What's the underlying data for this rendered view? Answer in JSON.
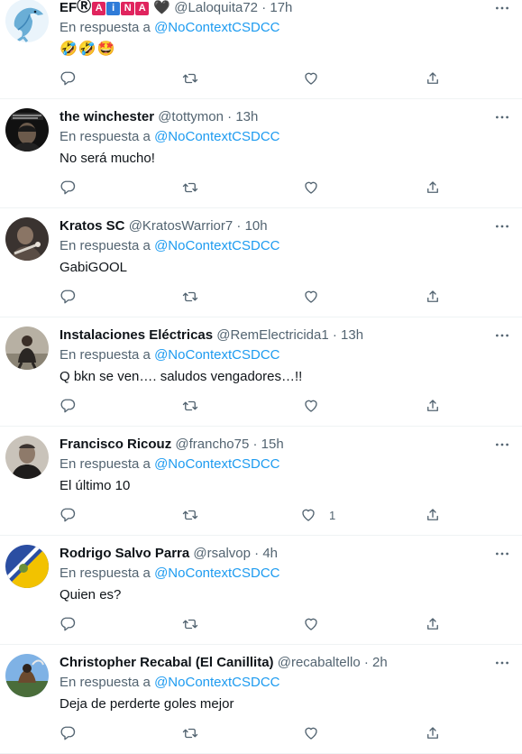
{
  "reply_prefix": "En respuesta a",
  "tweets": [
    {
      "name": "EF",
      "name_badges": [
        "Ⓡ",
        "A",
        "i",
        "N",
        "A"
      ],
      "name_heart": "🖤",
      "handle": "@Laloquita72",
      "separator": "·",
      "time": "17h",
      "mention": "@NoContextCSDCC",
      "text": "🤣🤣🤩",
      "likes": ""
    },
    {
      "name": "the winchester",
      "handle": "@tottymon",
      "separator": "·",
      "time": "13h",
      "mention": "@NoContextCSDCC",
      "text": "No será mucho!",
      "likes": ""
    },
    {
      "name": "Kratos SC",
      "handle": "@KratosWarrior7",
      "separator": "·",
      "time": "10h",
      "mention": "@NoContextCSDCC",
      "text": "GabiGOOL",
      "likes": ""
    },
    {
      "name": "Instalaciones Eléctricas",
      "handle": "@RemElectricida1",
      "separator": "·",
      "time": "13h",
      "mention": "@NoContextCSDCC",
      "text": "Q bkn se ven…. saludos vengadores…!!",
      "likes": ""
    },
    {
      "name": "Francisco Ricouz",
      "handle": "@francho75",
      "separator": "·",
      "time": "15h",
      "mention": "@NoContextCSDCC",
      "text": "El último 10",
      "likes": "1"
    },
    {
      "name": "Rodrigo Salvo Parra",
      "handle": "@rsalvop",
      "separator": "·",
      "time": "4h",
      "mention": "@NoContextCSDCC",
      "text": "Quien es?",
      "likes": ""
    },
    {
      "name": "Christopher Recabal (El Canillita)",
      "handle": "@recabaltello",
      "separator": "·",
      "time": "2h",
      "mention": "@NoContextCSDCC",
      "text": "Deja de perderte goles mejor",
      "likes": ""
    }
  ],
  "icons": {
    "reply": "reply-icon",
    "retweet": "retweet-icon",
    "like": "heart-icon",
    "share": "share-icon",
    "more": "more-icon"
  },
  "colors": {
    "link": "#1d9bf0",
    "secondary_text": "#536471",
    "primary_text": "#0f1419",
    "divider": "#eff3f4",
    "badge_red": "#e0245e",
    "badge_blue": "#2f7bd8"
  }
}
